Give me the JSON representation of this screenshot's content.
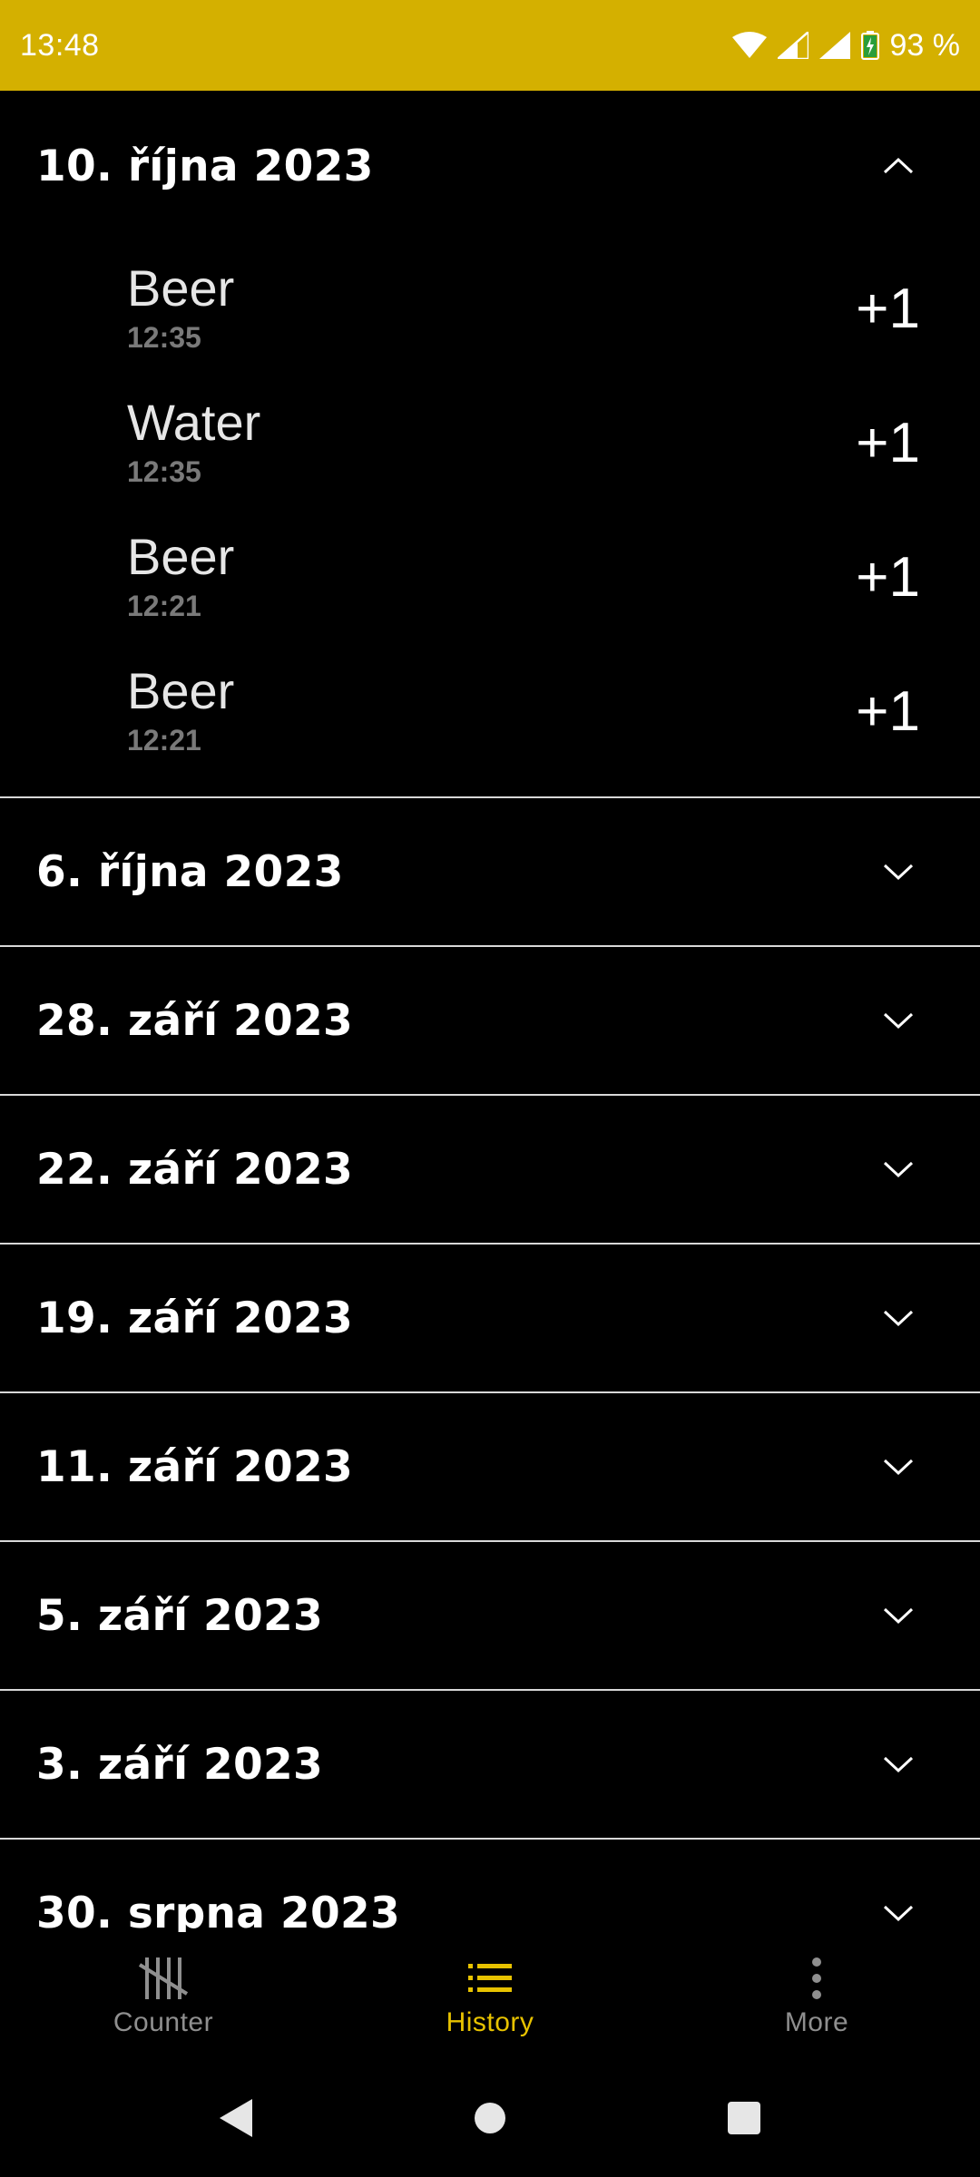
{
  "status_bar": {
    "time": "13:48",
    "battery": "93 %",
    "icons": [
      "wifi-icon",
      "signal-icon",
      "signal-icon",
      "battery-charging-icon"
    ]
  },
  "history": {
    "expanded": {
      "date": "10. října 2023",
      "entries": [
        {
          "name": "Beer",
          "time": "12:35",
          "amount": "+1"
        },
        {
          "name": "Water",
          "time": "12:35",
          "amount": "+1"
        },
        {
          "name": "Beer",
          "time": "12:21",
          "amount": "+1"
        },
        {
          "name": "Beer",
          "time": "12:21",
          "amount": "+1"
        }
      ]
    },
    "collapsed": [
      {
        "date": "6. října 2023"
      },
      {
        "date": "28. září 2023"
      },
      {
        "date": "22. září 2023"
      },
      {
        "date": "19. září 2023"
      },
      {
        "date": "11. září 2023"
      },
      {
        "date": "5. září 2023"
      },
      {
        "date": "3. září 2023"
      },
      {
        "date": "30. srpna 2023"
      }
    ]
  },
  "bottom_nav": {
    "items": [
      {
        "label": "Counter",
        "icon": "tally-icon",
        "active": false
      },
      {
        "label": "History",
        "icon": "list-icon",
        "active": true
      },
      {
        "label": "More",
        "icon": "more-vertical-icon",
        "active": false
      }
    ]
  },
  "colors": {
    "accent": "#e7c200",
    "status_bar": "#d4b000",
    "background": "#000000",
    "inactive": "#8f8f8f"
  }
}
